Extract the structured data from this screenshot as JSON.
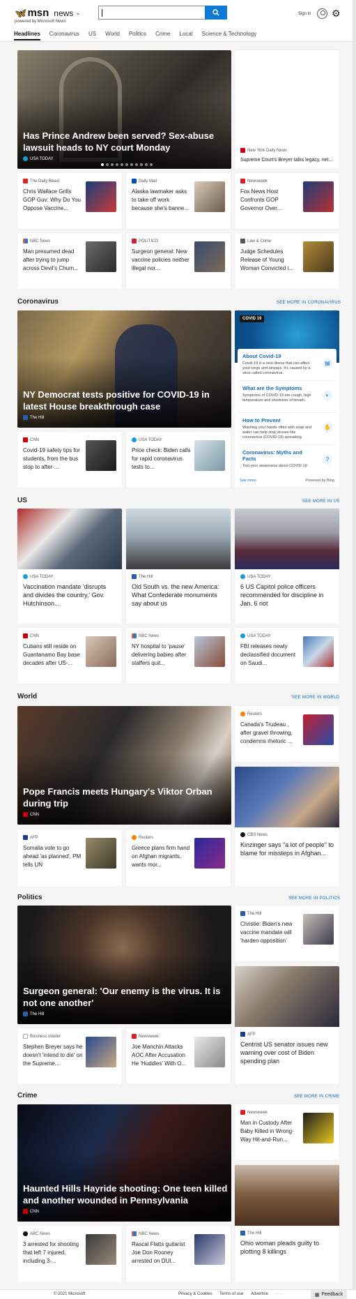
{
  "header": {
    "brand": "msn",
    "channel": "news",
    "powered": "powered by Microsoft News",
    "search_value": "",
    "sign_in": "Sign in"
  },
  "nav": [
    "Headlines",
    "Coronavirus",
    "US",
    "World",
    "Politics",
    "Crime",
    "Local",
    "Science & Technology"
  ],
  "top": {
    "hero": {
      "title": "Has Prince Andrew been served? Sex-abuse lawsuit heads to NY court Monday",
      "source": "USA TODAY",
      "slide": 1,
      "slides": 11
    },
    "side": {
      "source": "New York Daily News",
      "title": "Supreme Court's Breyer talks legacy, net..."
    },
    "cards": [
      {
        "source": "The Daily Beast",
        "title": "Chris Wallace Grills GOP Guv: Why Do You Oppose Vaccine..."
      },
      {
        "source": "Daily Mail",
        "title": "Alaska lawmaker asks to take off work because she's banne..."
      },
      {
        "source": "Newsweek",
        "title": "Fox News Host Confronts GOP Governor Over..."
      },
      {
        "source": "NBC News",
        "title": "Man presumed dead after trying to jump across Devil's Churn..."
      },
      {
        "source": "POLITICO",
        "title": "Surgeon general: New vaccine policies neither illegal nor..."
      },
      {
        "source": "Law & Crime",
        "title": "Judge Schedules Release of Young Woman Convicted i..."
      }
    ]
  },
  "coronavirus": {
    "title": "Coronavirus",
    "more": "SEE MORE IN CORONAVIRUS",
    "hero": {
      "title": "NY Democrat tests positive for COVID-19 in latest House breakthrough case",
      "source": "The Hill"
    },
    "cards": [
      {
        "source": "CNN",
        "title": "Covid-19 safety tips for students, from the bus stop to after-..."
      },
      {
        "source": "USA TODAY",
        "title": "Price check: Biden calls for rapid coronavirus tests to..."
      }
    ],
    "widget": {
      "badge": "COVID 19",
      "items": [
        {
          "head": "About Covid-19",
          "desc": "Covid-19 is a new illness that can affect your lungs and airways. It's caused by a virus called coronavirus."
        },
        {
          "head": "What are the Symptoms",
          "desc": "Symptoms of COVID-19 are cough, high temperature and shortness of breath."
        },
        {
          "head": "How to Prevent",
          "desc": "Washing your hands often with soap and water can help stop viruses like coronavirus (COVID-19) spreading."
        },
        {
          "head": "Coronavirus: Myths and Facts",
          "desc": "Test your awareness about COVID-19."
        }
      ],
      "see_more": "See more",
      "powered": "Powered by Bing"
    }
  },
  "us": {
    "title": "US",
    "more": "SEE MORE IN US",
    "img_cards": [
      {
        "source": "USA TODAY",
        "title": "Vaccination mandate 'disrupts and divides the country,' Gov. Hutchinson..."
      },
      {
        "source": "The Hill",
        "title": "Old South vs. the new America: What Confederate monuments say about us"
      },
      {
        "source": "USA TODAY",
        "title": "6 US Capitol police officers recommended for discipline in Jan. 6 riot"
      }
    ],
    "cards": [
      {
        "source": "CNN",
        "title": "Cubans still reside on Guantanamo Bay base decades after US-..."
      },
      {
        "source": "NBC News",
        "title": "NY hospital to 'pause' delivering babies after staffers quit..."
      },
      {
        "source": "USA TODAY",
        "title": "FBI releases newly declassified document on Saudi..."
      }
    ]
  },
  "world": {
    "title": "World",
    "more": "SEE MORE IN WORLD",
    "hero": {
      "title": "Pope Francis meets Hungary's Viktor Orban during trip",
      "source": "CNN"
    },
    "side": {
      "source": "Reuters",
      "title": "Canada's Trudeau , after gravel throwing, condemns rhetoric ..."
    },
    "side_img": {
      "source": "CBS News",
      "title": "Kinzinger says \"a lot of people\" to blame for missteps in Afghan..."
    },
    "cards": [
      {
        "source": "AFP",
        "title": "Somalia vote to go ahead 'as planned', PM tells UN"
      },
      {
        "source": "Reuters",
        "title": "Greece plans firm hand on Afghan migrants, wants mor..."
      }
    ]
  },
  "politics": {
    "title": "Politics",
    "more": "SEE MORE IN POLITICS",
    "hero": {
      "title": "Surgeon general: 'Our enemy is the virus. It is not one another'",
      "source": "The Hill"
    },
    "side": {
      "source": "The Hill",
      "title": "Christie: Biden's new vaccine mandate will 'harden opposition'"
    },
    "side_img": {
      "source": "AFP",
      "title": "Centrist US senator issues new warning over cost of Biden spending plan"
    },
    "cards": [
      {
        "source": "Business Insider",
        "title": "Stephen Breyer says he doesn't 'intend to die' on the Supreme..."
      },
      {
        "source": "Newsweek",
        "title": "Joe Manchin Attacks AOC After Accusation He 'Huddles' With O..."
      }
    ]
  },
  "crime": {
    "title": "Crime",
    "more": "SEE MORE IN CRIME",
    "hero": {
      "title": "Haunted Hills Hayride shooting: One teen killed and another wounded in Pennsylvania",
      "source": "CNN"
    },
    "side": {
      "source": "Newsweek",
      "title": "Man in Custody After Baby Killed in Wrong-Way Hit-and-Run..."
    },
    "side_img": {
      "source": "The Hill",
      "title": "Ohio woman pleads guilty to plotting 8 killings"
    },
    "cards": [
      {
        "source": "ABC News",
        "title": "3 arrested for shooting that left 7 injured, including 3-..."
      },
      {
        "source": "NBC News",
        "title": "Rascal Flatts guitarist Joe Don Rooney arrested on DUI..."
      }
    ]
  },
  "footer": {
    "copyright": "© 2021 Microsoft",
    "privacy": "Privacy & Cookies",
    "terms": "Terms of use",
    "advertise": "Advertise",
    "more": "· · ·",
    "feedback": "Feedback"
  }
}
